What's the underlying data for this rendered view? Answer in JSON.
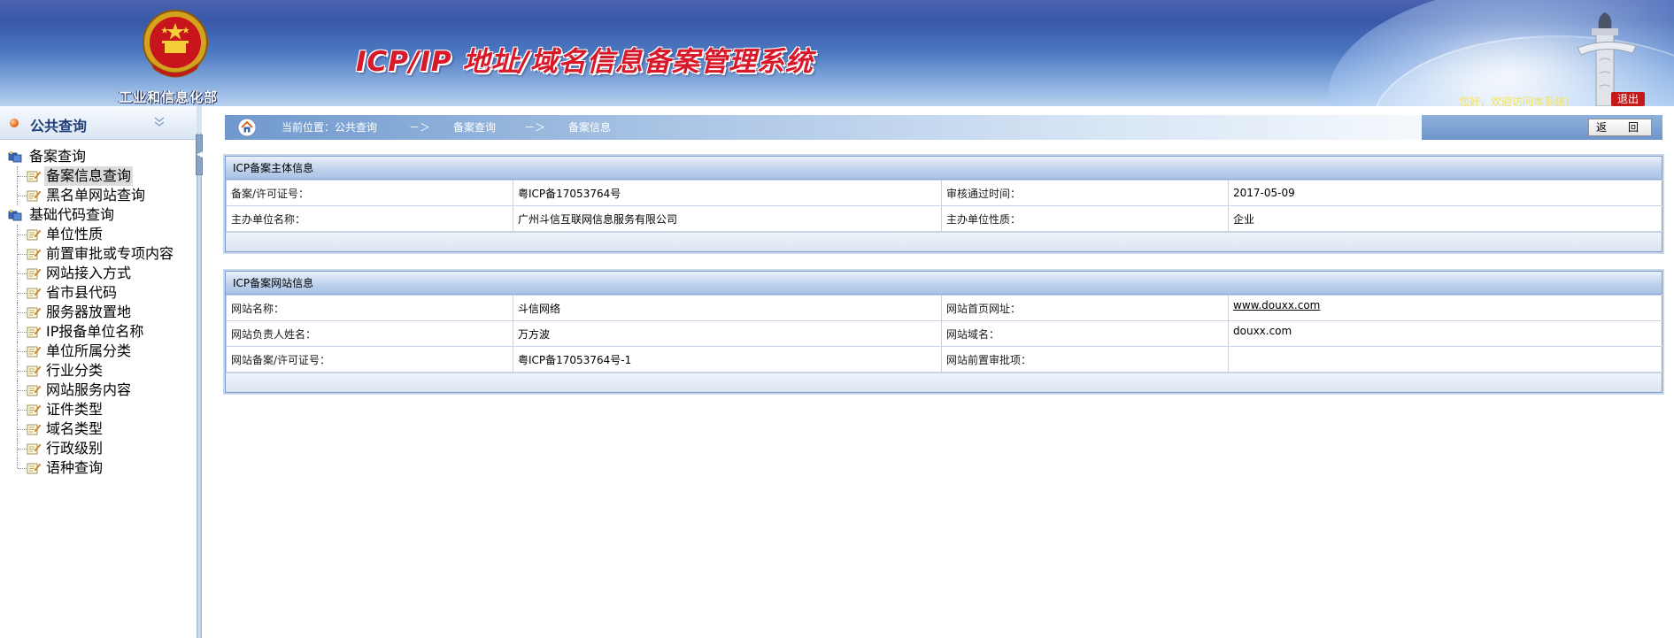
{
  "header": {
    "ministry_name": "工业和信息化部",
    "system_title": "ICP/IP 地址/域名信息备案管理系统",
    "welcome_text": "您好，欢迎访问本系统！",
    "logout_label": "退出",
    "emblem_icon": "national-emblem-icon",
    "pillar_icon": "huabiao-pillar-icon"
  },
  "sidebar": {
    "title": "公共查询",
    "collapse_icon": "double-chevron-up-icon",
    "groups": [
      {
        "label": "备案查询",
        "items": [
          {
            "label": "备案信息查询",
            "selected": true
          },
          {
            "label": "黑名单网站查询",
            "selected": false
          }
        ]
      },
      {
        "label": "基础代码查询",
        "items": [
          {
            "label": "单位性质"
          },
          {
            "label": "前置审批或专项内容"
          },
          {
            "label": "网站接入方式"
          },
          {
            "label": "省市县代码"
          },
          {
            "label": "服务器放置地"
          },
          {
            "label": "IP报备单位名称"
          },
          {
            "label": "单位所属分类"
          },
          {
            "label": "行业分类"
          },
          {
            "label": "网站服务内容"
          },
          {
            "label": "证件类型"
          },
          {
            "label": "域名类型"
          },
          {
            "label": "行政级别"
          },
          {
            "label": "语种查询"
          }
        ]
      }
    ]
  },
  "breadcrumb": {
    "prefix": "当前位置：公共查询",
    "separator": "－＞",
    "level2": "备案查询",
    "level3": "备案信息"
  },
  "back_button": "返　回",
  "subject_panel": {
    "title": "ICP备案主体信息",
    "rows": [
      {
        "label1": "备案/许可证号：",
        "value1": "粤ICP备17053764号",
        "label2": "审核通过时间：",
        "value2": "2017-05-09"
      },
      {
        "label1": "主办单位名称：",
        "value1": "广州斗信互联网信息服务有限公司",
        "label2": "主办单位性质：",
        "value2": "企业"
      }
    ]
  },
  "website_panel": {
    "title": "ICP备案网站信息",
    "rows": [
      {
        "label1": "网站名称：",
        "value1": "斗信网络",
        "label2": "网站首页网址：",
        "value2": "www.douxx.com"
      },
      {
        "label1": "网站负责人姓名：",
        "value1": "万方波",
        "label2": "网站域名：",
        "value2": "douxx.com"
      },
      {
        "label1": "网站备案/许可证号：",
        "value1": "粤ICP备17053764号-1",
        "label2": "网站前置审批项：",
        "value2": ""
      }
    ]
  },
  "colors": {
    "title_red": "#d8192a",
    "header_blue": "#3858a8",
    "panel_border": "#7d9ccc",
    "logout_red": "#c41a1a",
    "welcome_yellow": "#f6e25a"
  }
}
